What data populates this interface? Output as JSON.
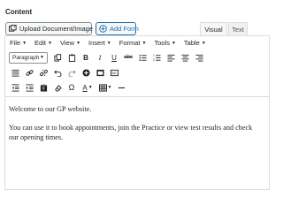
{
  "section": {
    "title": "Content"
  },
  "buttons": {
    "upload": "Upload Document/Image",
    "add_form": "Add Form"
  },
  "tabs": [
    {
      "label": "Visual",
      "active": true
    },
    {
      "label": "Text",
      "active": false
    }
  ],
  "menubar": [
    "File",
    "Edit",
    "View",
    "Insert",
    "Format",
    "Tools",
    "Table"
  ],
  "toolbar": {
    "format_select": "Paragraph",
    "row1_icons": [
      "copy-icon",
      "paste-icon",
      "bold-icon",
      "italic-icon",
      "underline-icon",
      "strikethrough-icon",
      "bullet-list-icon",
      "numbered-list-icon",
      "align-left-icon",
      "align-center-icon",
      "align-right-icon"
    ],
    "row2_icons": [
      "align-justify-icon",
      "link-icon",
      "unlink-icon",
      "undo-icon",
      "redo-icon",
      "add-icon",
      "fullscreen-icon",
      "cc-icon"
    ],
    "row3_icons": [
      "outdent-icon",
      "indent-icon",
      "paste-text-icon",
      "clear-format-icon",
      "omega-icon",
      "text-color-icon",
      "table-icon",
      "horizontal-line-icon"
    ]
  },
  "content": {
    "paragraphs": [
      "Welcome to our GP website.",
      "You can use it to book appointments, join the Practice or view test results and check our opening times."
    ]
  },
  "colors": {
    "accent": "#2271b1",
    "border": "#dcdcde",
    "text": "#1d2327"
  }
}
